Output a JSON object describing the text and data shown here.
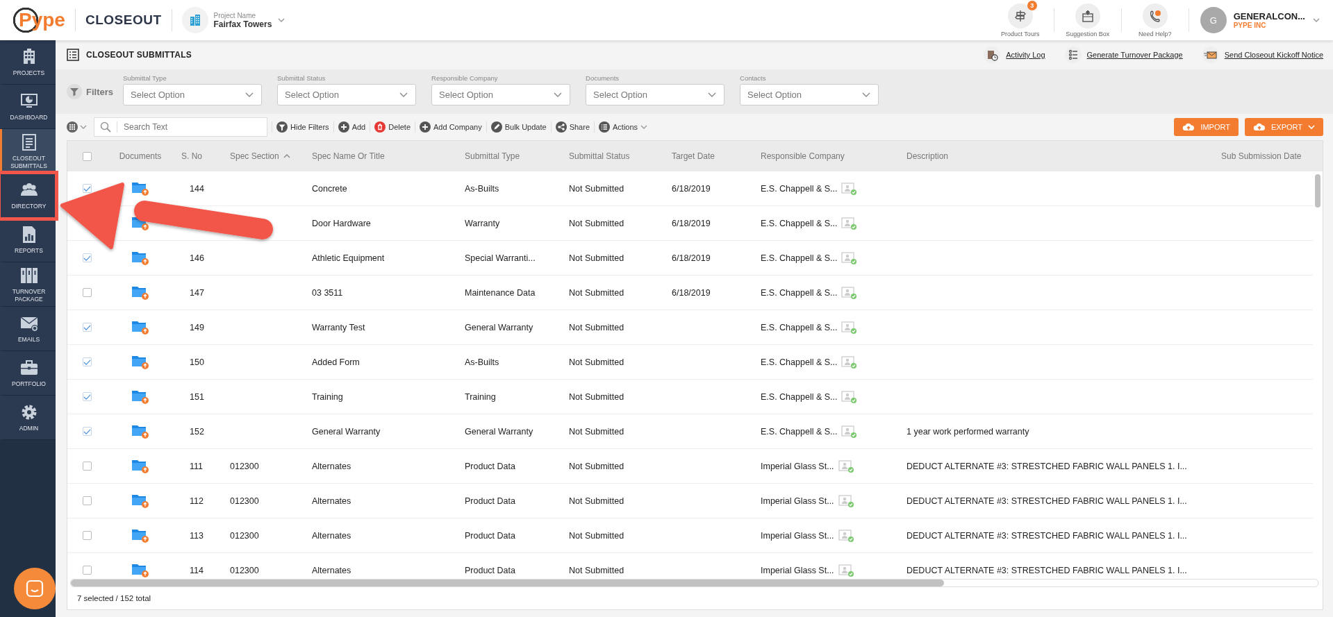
{
  "header": {
    "logo": "Pype",
    "module": "CLOSEOUT",
    "project": {
      "label": "Project Name",
      "name": "Fairfax Towers"
    },
    "tools": [
      {
        "kind": "tours",
        "label": "Product Tours",
        "badge": "3"
      },
      {
        "kind": "suggestion",
        "label": "Suggestion Box"
      },
      {
        "kind": "help",
        "label": "Need Help?"
      }
    ],
    "user": {
      "initial": "G",
      "name": "GENERALCON...",
      "company": "PYPE INC"
    }
  },
  "sidebar": {
    "items": [
      {
        "kind": "projects",
        "label": "PROJECTS",
        "selected": false,
        "highlighted": false
      },
      {
        "kind": "dashboard",
        "label": "DASHBOARD",
        "selected": false,
        "highlighted": false
      },
      {
        "kind": "closeout",
        "label": "CLOSEOUT SUBMITTALS",
        "selected": true,
        "highlighted": false
      },
      {
        "kind": "directory",
        "label": "DIRECTORY",
        "selected": false,
        "highlighted": true
      },
      {
        "kind": "reports",
        "label": "REPORTS",
        "selected": false,
        "highlighted": false
      },
      {
        "kind": "turnover",
        "label": "TURNOVER PACKAGE",
        "selected": false,
        "highlighted": false
      },
      {
        "kind": "emails",
        "label": "EMAILS",
        "selected": false,
        "highlighted": false
      },
      {
        "kind": "portfolio",
        "label": "PORTFOLIO",
        "selected": false,
        "highlighted": false
      },
      {
        "kind": "admin",
        "label": "ADMIN",
        "selected": false,
        "highlighted": false
      }
    ]
  },
  "page": {
    "title": "CLOSEOUT SUBMITTALS",
    "links": [
      {
        "kind": "log",
        "label": "Activity Log"
      },
      {
        "kind": "package",
        "label": "Generate Turnover Package"
      },
      {
        "kind": "mail",
        "label": "Send Closeout Kickoff Notice"
      }
    ]
  },
  "filters": {
    "label": "Filters",
    "fields": [
      {
        "label": "Submittal Type",
        "placeholder": "Select Option"
      },
      {
        "label": "Submittal Status",
        "placeholder": "Select Option"
      },
      {
        "label": "Responsible Company",
        "placeholder": "Select Option"
      },
      {
        "label": "Documents",
        "placeholder": "Select Option"
      },
      {
        "label": "Contacts",
        "placeholder": "Select Option"
      }
    ]
  },
  "toolbar": {
    "search": {
      "placeholder": "Search Text"
    },
    "actions": [
      {
        "kind": "filter",
        "label": "Hide Filters"
      },
      {
        "kind": "plus",
        "label": "Add"
      },
      {
        "kind": "delete",
        "label": "Delete"
      },
      {
        "kind": "plus",
        "label": "Add Company"
      },
      {
        "kind": "pencil",
        "label": "Bulk Update"
      },
      {
        "kind": "share",
        "label": "Share"
      },
      {
        "kind": "list",
        "label": "Actions"
      }
    ],
    "buttons": [
      {
        "kind": "import",
        "label": "IMPORT"
      },
      {
        "kind": "export",
        "label": "EXPORT"
      }
    ]
  },
  "table": {
    "all_checked": false,
    "columns": [
      "Documents",
      "S. No",
      "Spec Section",
      "Spec Name Or Title",
      "Submittal Type",
      "Submittal Status",
      "Target Date",
      "Responsible Company",
      "Description",
      "Sub Submission Date"
    ],
    "rows": [
      {
        "checked": true,
        "s_no": "144",
        "spec_section": "",
        "spec_name": "Concrete",
        "type": "As-Builts",
        "status": "Not Submitted",
        "target_date": "6/18/2019",
        "company": "E.S. Chappell & S...",
        "description": ""
      },
      {
        "spec_section": "",
        "spec_name": "Door Hardware",
        "type": "Warranty",
        "status": "Not Submitted",
        "target_date": "6/18/2019",
        "company": "E.S. Chappell & S...",
        "description": ""
      },
      {
        "checked": true,
        "s_no": "146",
        "spec_section": "",
        "spec_name": "Athletic Equipment",
        "type": "Special Warranti...",
        "status": "Not Submitted",
        "target_date": "6/18/2019",
        "company": "E.S. Chappell & S...",
        "description": ""
      },
      {
        "checked": false,
        "s_no": "147",
        "spec_section": "",
        "spec_name": "03 3511",
        "type": "Maintenance Data",
        "status": "Not Submitted",
        "target_date": "6/18/2019",
        "company": "E.S. Chappell & S...",
        "description": ""
      },
      {
        "checked": true,
        "s_no": "149",
        "spec_section": "",
        "spec_name": "Warranty Test",
        "type": "General Warranty",
        "status": "Not Submitted",
        "target_date": "",
        "company": "E.S. Chappell & S...",
        "description": ""
      },
      {
        "checked": true,
        "s_no": "150",
        "spec_section": "",
        "spec_name": "Added Form",
        "type": "As-Builts",
        "status": "Not Submitted",
        "target_date": "",
        "company": "E.S. Chappell & S...",
        "description": ""
      },
      {
        "checked": true,
        "s_no": "151",
        "spec_section": "",
        "spec_name": "Training",
        "type": "Training",
        "status": "Not Submitted",
        "target_date": "",
        "company": "E.S. Chappell & S...",
        "description": ""
      },
      {
        "checked": true,
        "s_no": "152",
        "spec_section": "",
        "spec_name": "General Warranty",
        "type": "General Warranty",
        "status": "Not Submitted",
        "target_date": "",
        "company": "E.S. Chappell & S...",
        "description": "1 year work performed warranty"
      },
      {
        "checked": false,
        "s_no": "111",
        "spec_section": "012300",
        "spec_name": "Alternates",
        "type": "Product Data",
        "status": "Not Submitted",
        "target_date": "",
        "company": "Imperial Glass St...",
        "description": "DEDUCT ALTERNATE #3: STRESTCHED FABRIC WALL PANELS 1. I..."
      },
      {
        "checked": false,
        "s_no": "112",
        "spec_section": "012300",
        "spec_name": "Alternates",
        "type": "Product Data",
        "status": "Not Submitted",
        "target_date": "",
        "company": "Imperial Glass St...",
        "description": "DEDUCT ALTERNATE #3: STRESTCHED FABRIC WALL PANELS 1. I..."
      },
      {
        "checked": false,
        "s_no": "113",
        "spec_section": "012300",
        "spec_name": "Alternates",
        "type": "Product Data",
        "status": "Not Submitted",
        "target_date": "",
        "company": "Imperial Glass St...",
        "description": "DEDUCT ALTERNATE #3: STRESTCHED FABRIC WALL PANELS 1. I..."
      },
      {
        "checked": false,
        "s_no": "114",
        "spec_section": "012300",
        "spec_name": "Alternates",
        "type": "Product Data",
        "status": "Not Submitted",
        "target_date": "",
        "company": "Imperial Glass St...",
        "description": "DEDUCT ALTERNATE #3: STRESTCHED FABRIC WALL PANELS 1. I..."
      }
    ],
    "footer": "7 selected / 152 total"
  }
}
